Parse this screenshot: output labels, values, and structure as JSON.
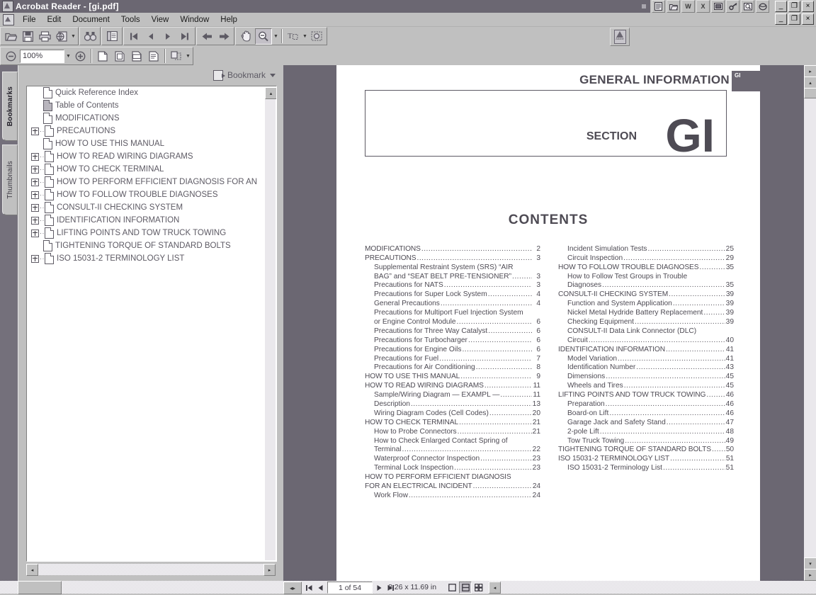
{
  "window": {
    "title": "Acrobat Reader - [gi.pdf]",
    "app_icon": "acrobat-icon",
    "minimize_label": "_",
    "maximize_label": "❐",
    "close_label": "×"
  },
  "menubar": {
    "items": [
      {
        "label": "File",
        "name": "menu-file"
      },
      {
        "label": "Edit",
        "name": "menu-edit"
      },
      {
        "label": "Document",
        "name": "menu-document"
      },
      {
        "label": "Tools",
        "name": "menu-tools"
      },
      {
        "label": "View",
        "name": "menu-view"
      },
      {
        "label": "Window",
        "name": "menu-window"
      },
      {
        "label": "Help",
        "name": "menu-help"
      }
    ]
  },
  "applets": [
    {
      "name": "applet-notepad",
      "glyph": "☰"
    },
    {
      "name": "applet-explorer",
      "glyph": "⌸"
    },
    {
      "name": "applet-word",
      "glyph": "W"
    },
    {
      "name": "applet-excel",
      "glyph": "X"
    },
    {
      "name": "applet-display",
      "glyph": "▣"
    },
    {
      "name": "applet-key",
      "glyph": "⚷"
    },
    {
      "name": "applet-find",
      "glyph": "▦"
    },
    {
      "name": "applet-internet",
      "glyph": "●"
    }
  ],
  "toolbar_row1": [
    {
      "name": "open-button",
      "icon": "folder-open-icon"
    },
    {
      "name": "save-button",
      "icon": "save-floppy-icon"
    },
    {
      "name": "print-button",
      "icon": "printer-icon"
    },
    {
      "name": "web-capture-button",
      "icon": "globe-page-icon",
      "has_caret": true
    },
    {
      "name": "find-button",
      "icon": "binoculars-icon"
    },
    {
      "name": "show-hide-navigation-button",
      "icon": "navigation-pane-icon"
    },
    {
      "name": "first-page-button",
      "icon": "first-page-icon"
    },
    {
      "name": "previous-page-button",
      "icon": "previous-page-icon"
    },
    {
      "name": "next-page-button",
      "icon": "next-page-icon"
    },
    {
      "name": "last-page-button",
      "icon": "last-page-icon"
    },
    {
      "name": "go-back-button",
      "icon": "arrow-left-icon"
    },
    {
      "name": "go-forward-button",
      "icon": "arrow-right-icon"
    },
    {
      "name": "hand-tool-button",
      "icon": "hand-icon"
    },
    {
      "name": "zoom-out-tool-button",
      "icon": "magnifier-minus-icon",
      "selected": true,
      "has_caret": true
    },
    {
      "name": "text-select-tool-button",
      "icon": "text-select-icon",
      "has_caret": true
    },
    {
      "name": "graphic-select-tool-button",
      "icon": "graphic-select-icon"
    }
  ],
  "toolbar_row2": {
    "zoom_out_button": "zoom-out-icon",
    "zoom_value": "100%",
    "zoom_caret": "▼",
    "zoom_in_button": "zoom-in-icon",
    "view_buttons": [
      {
        "name": "actual-size-button",
        "icon": "actual-size-icon"
      },
      {
        "name": "fit-in-window-button",
        "icon": "fit-page-icon"
      },
      {
        "name": "fit-width-button",
        "icon": "fit-width-icon"
      },
      {
        "name": "reflow-button",
        "icon": "reflow-icon"
      }
    ],
    "page_layout_button": {
      "name": "page-layout-button",
      "icon": "page-layout-icon",
      "has_caret": true
    }
  },
  "adobe_badge": {
    "name": "adobe-logo-button",
    "caption": "Adobe"
  },
  "navigation_tabs": [
    {
      "label": "Bookmarks",
      "name": "tab-bookmarks",
      "active": true
    },
    {
      "label": "Thumbnails",
      "name": "tab-thumbnails",
      "active": false
    }
  ],
  "bookmarks_panel": {
    "menu_label": "Bookmark",
    "menu_icon": "bookmark-options-icon",
    "caret": "▼",
    "items": [
      {
        "label": "Quick Reference Index",
        "expandable": false,
        "selected": false
      },
      {
        "label": "Table of Contents",
        "expandable": false,
        "selected": true
      },
      {
        "label": "MODIFICATIONS",
        "expandable": false,
        "selected": false
      },
      {
        "label": "PRECAUTIONS",
        "expandable": true,
        "selected": false
      },
      {
        "label": "HOW TO USE THIS MANUAL",
        "expandable": false,
        "selected": false
      },
      {
        "label": "HOW TO READ WIRING DIAGRAMS",
        "expandable": true,
        "selected": false
      },
      {
        "label": "HOW TO CHECK TERMINAL",
        "expandable": true,
        "selected": false
      },
      {
        "label": "HOW TO PERFORM EFFICIENT DIAGNOSIS FOR AN",
        "expandable": true,
        "selected": false
      },
      {
        "label": "HOW TO FOLLOW TROUBLE DIAGNOSES",
        "expandable": true,
        "selected": false
      },
      {
        "label": "CONSULT-II CHECKING SYSTEM",
        "expandable": true,
        "selected": false
      },
      {
        "label": "IDENTIFICATION INFORMATION",
        "expandable": true,
        "selected": false
      },
      {
        "label": "LIFTING POINTS AND TOW TRUCK TOWING",
        "expandable": true,
        "selected": false
      },
      {
        "label": "TIGHTENING TORQUE OF STANDARD BOLTS",
        "expandable": false,
        "selected": false
      },
      {
        "label": "ISO 15031-2 TERMINOLOGY LIST",
        "expandable": true,
        "selected": false
      }
    ]
  },
  "document": {
    "header_title": "GENERAL INFORMATION",
    "section_tab": "GI",
    "section_word": "SECTION",
    "section_code": "GI",
    "contents_title": "CONTENTS",
    "toc_left": [
      {
        "label": "MODIFICATIONS",
        "page": "2",
        "level": 0
      },
      {
        "label": "PRECAUTIONS",
        "page": "3",
        "level": 0
      },
      {
        "label": "Supplemental Restraint System (SRS) “AIR",
        "page": "",
        "level": 1
      },
      {
        "label": "BAG” and “SEAT BELT PRE-TENSIONER”",
        "page": "3",
        "level": 1
      },
      {
        "label": "Precautions for NATS",
        "page": "3",
        "level": 1
      },
      {
        "label": "Precautions for Super Lock System",
        "page": "4",
        "level": 1
      },
      {
        "label": "General Precautions",
        "page": "4",
        "level": 1
      },
      {
        "label": "Precautions for Multiport Fuel Injection System",
        "page": "",
        "level": 1
      },
      {
        "label": "or Engine Control Module",
        "page": "6",
        "level": 1
      },
      {
        "label": "Precautions for Three Way Catalyst",
        "page": "6",
        "level": 1
      },
      {
        "label": "Precautions for Turbocharger",
        "page": "6",
        "level": 1
      },
      {
        "label": "Precautions for Engine Oils",
        "page": "6",
        "level": 1
      },
      {
        "label": "Precautions for Fuel",
        "page": "7",
        "level": 1
      },
      {
        "label": "Precautions for Air Conditioning",
        "page": "8",
        "level": 1
      },
      {
        "label": "HOW TO USE THIS MANUAL",
        "page": "9",
        "level": 0
      },
      {
        "label": "HOW TO READ WIRING DIAGRAMS",
        "page": "11",
        "level": 0
      },
      {
        "label": "Sample/Wiring Diagram — EXAMPL —",
        "page": "11",
        "level": 1
      },
      {
        "label": "Description",
        "page": "13",
        "level": 1
      },
      {
        "label": "Wiring Diagram Codes (Cell Codes)",
        "page": "20",
        "level": 1
      },
      {
        "label": "HOW TO CHECK TERMINAL",
        "page": "21",
        "level": 0
      },
      {
        "label": "How to Probe Connectors",
        "page": "21",
        "level": 1
      },
      {
        "label": "How to Check Enlarged Contact Spring of",
        "page": "",
        "level": 1
      },
      {
        "label": "Terminal",
        "page": "22",
        "level": 1
      },
      {
        "label": "Waterproof Connector Inspection",
        "page": "23",
        "level": 1
      },
      {
        "label": "Terminal Lock Inspection",
        "page": "23",
        "level": 1
      },
      {
        "label": "HOW TO PERFORM EFFICIENT DIAGNOSIS",
        "page": "",
        "level": 0
      },
      {
        "label": "FOR AN ELECTRICAL INCIDENT",
        "page": "24",
        "level": 0
      },
      {
        "label": "Work Flow",
        "page": "24",
        "level": 1
      }
    ],
    "toc_right": [
      {
        "label": "Incident Simulation Tests",
        "page": "25",
        "level": 1
      },
      {
        "label": "Circuit Inspection",
        "page": "29",
        "level": 1
      },
      {
        "label": "HOW TO FOLLOW TROUBLE DIAGNOSES",
        "page": "35",
        "level": 0
      },
      {
        "label": "How to Follow Test Groups in Trouble",
        "page": "",
        "level": 1
      },
      {
        "label": "Diagnoses",
        "page": "35",
        "level": 1
      },
      {
        "label": "CONSULT-II CHECKING SYSTEM",
        "page": "39",
        "level": 0
      },
      {
        "label": "Function and System Application",
        "page": "39",
        "level": 1
      },
      {
        "label": "Nickel Metal Hydride Battery Replacement",
        "page": "39",
        "level": 1
      },
      {
        "label": "Checking Equipment",
        "page": "39",
        "level": 1
      },
      {
        "label": "CONSULT-II Data Link Connector (DLC)",
        "page": "",
        "level": 1
      },
      {
        "label": "Circuit",
        "page": "40",
        "level": 1
      },
      {
        "label": "IDENTIFICATION INFORMATION",
        "page": "41",
        "level": 0
      },
      {
        "label": "Model Variation",
        "page": "41",
        "level": 1
      },
      {
        "label": "Identification Number",
        "page": "43",
        "level": 1
      },
      {
        "label": "Dimensions",
        "page": "45",
        "level": 1
      },
      {
        "label": "Wheels and Tires",
        "page": "45",
        "level": 1
      },
      {
        "label": "LIFTING POINTS AND TOW TRUCK TOWING",
        "page": "46",
        "level": 0
      },
      {
        "label": "Preparation",
        "page": "46",
        "level": 1
      },
      {
        "label": "Board-on Lift",
        "page": "46",
        "level": 1
      },
      {
        "label": "Garage Jack and Safety Stand",
        "page": "47",
        "level": 1
      },
      {
        "label": "2-pole Lift",
        "page": "48",
        "level": 1
      },
      {
        "label": "Tow Truck Towing",
        "page": "49",
        "level": 1
      },
      {
        "label": "TIGHTENING TORQUE OF STANDARD BOLTS",
        "page": "50",
        "level": 0
      },
      {
        "label": "ISO 15031-2 TERMINOLOGY LIST",
        "page": "51",
        "level": 0
      },
      {
        "label": "ISO 15031-2 Terminology List",
        "page": "51",
        "level": 1
      }
    ]
  },
  "statusbar": {
    "page_indicator": "1 of 54",
    "page_dimensions": "8.26 x 11.69 in",
    "first_page_icon": "◀❘",
    "prev_page_icon": "◀",
    "next_page_icon": "▶",
    "last_page_icon": "❘▶",
    "mode_single": "single-page-mode-icon",
    "mode_continuous": "continuous-mode-icon",
    "mode_facing": "continuous-facing-mode-icon",
    "resize_icon": "resize-grip-icon"
  },
  "colors": {
    "window_chrome": "#c0c0c0",
    "titlebar": "#6b6772",
    "workspace_bg": "#6b6772",
    "page_bg": "#ffffff",
    "doc_text": "#4e4b54",
    "bookmark_text": "#5d5a64"
  }
}
